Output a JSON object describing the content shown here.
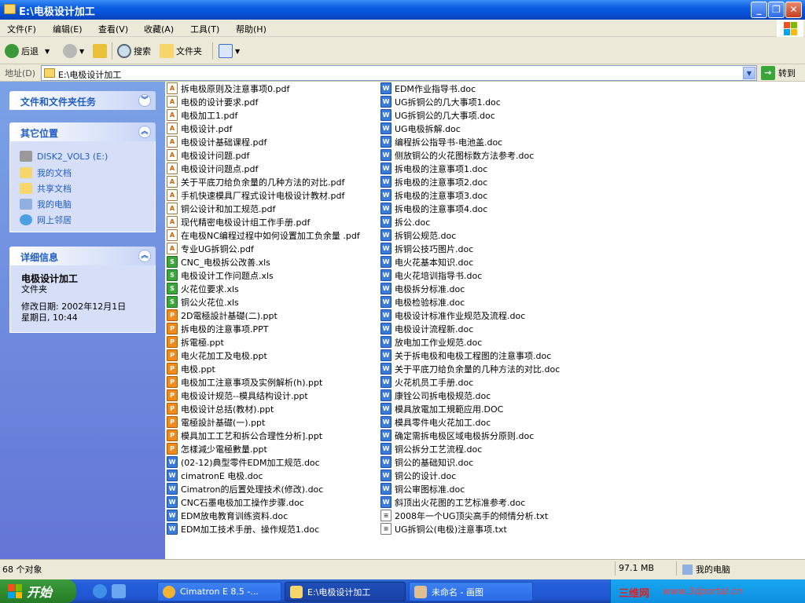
{
  "window": {
    "title": "E:\\电极设计加工"
  },
  "menu": [
    "文件(F)",
    "编辑(E)",
    "查看(V)",
    "收藏(A)",
    "工具(T)",
    "帮助(H)"
  ],
  "toolbar": {
    "back": "后退",
    "search": "搜索",
    "folders": "文件夹"
  },
  "address": {
    "label": "地址(D)",
    "path": "E:\\电极设计加工",
    "go": "转到"
  },
  "tasks_panel": {
    "title": "文件和文件夹任务"
  },
  "other_places": {
    "title": "其它位置",
    "items": [
      "DISK2_VOL3 (E:)",
      "我的文档",
      "共享文档",
      "我的电脑",
      "网上邻居"
    ]
  },
  "details": {
    "title": "详细信息",
    "name": "电极设计加工",
    "type": "文件夹",
    "modified_line1": "修改日期: 2002年12月1日",
    "modified_line2": "星期日, 10:44"
  },
  "files_col1": [
    {
      "name": "拆电极原则及注意事项0.pdf",
      "type": "pdf"
    },
    {
      "name": "电极的设计要求.pdf",
      "type": "pdf"
    },
    {
      "name": "电极加工1.pdf",
      "type": "pdf"
    },
    {
      "name": "电极设计.pdf",
      "type": "pdf"
    },
    {
      "name": "电极设计基础课程.pdf",
      "type": "pdf"
    },
    {
      "name": "电极设计问题.pdf",
      "type": "pdf"
    },
    {
      "name": "电极设计问题点.pdf",
      "type": "pdf"
    },
    {
      "name": "关于平底刀给负余量的几种方法的对比.pdf",
      "type": "pdf"
    },
    {
      "name": "手机快速模具厂程式设计电极设计教材.pdf",
      "type": "pdf"
    },
    {
      "name": "铜公设计和加工规范.pdf",
      "type": "pdf"
    },
    {
      "name": "现代精密电极设计组工作手册.pdf",
      "type": "pdf"
    },
    {
      "name": "在电极NC编程过程中如何设置加工负余量 .pdf",
      "type": "pdf"
    },
    {
      "name": "专业UG拆铜公.pdf",
      "type": "pdf"
    },
    {
      "name": "CNC_电极拆公改善.xls",
      "type": "xls"
    },
    {
      "name": "电极设计工作问题点.xls",
      "type": "xls"
    },
    {
      "name": "火花位要求.xls",
      "type": "xls"
    },
    {
      "name": "铜公火花位.xls",
      "type": "xls"
    },
    {
      "name": "2D電極設計基礎(二).ppt",
      "type": "ppt"
    },
    {
      "name": "拆电极的注意事项.PPT",
      "type": "ppt"
    },
    {
      "name": "拆電極.ppt",
      "type": "ppt"
    },
    {
      "name": "电火花加工及电极.ppt",
      "type": "ppt"
    },
    {
      "name": "电极.ppt",
      "type": "ppt"
    },
    {
      "name": "电极加工注意事项及实例解析(h).ppt",
      "type": "ppt"
    },
    {
      "name": "电极设计规范--模具结构设计.ppt",
      "type": "ppt"
    },
    {
      "name": "电极设计总括(教材).ppt",
      "type": "ppt"
    },
    {
      "name": "電極設計基礎(一).ppt",
      "type": "ppt"
    },
    {
      "name": "模具加工工艺和拆公合理性分析].ppt",
      "type": "ppt"
    },
    {
      "name": "怎樣減少電極數量.ppt",
      "type": "ppt"
    },
    {
      "name": "(02-12)典型零件EDM加工规范.doc",
      "type": "doc"
    },
    {
      "name": "cimatronE 电极.doc",
      "type": "doc"
    },
    {
      "name": "Cimatron的后置处理技术(修改).doc",
      "type": "doc"
    },
    {
      "name": "CNC石墨电极加工操作步骤.doc",
      "type": "doc"
    },
    {
      "name": "EDM放电教育训练资料.doc",
      "type": "doc"
    },
    {
      "name": "EDM加工技术手册、操作规范1.doc",
      "type": "doc"
    }
  ],
  "files_col2": [
    {
      "name": "EDM作业指导书.doc",
      "type": "doc"
    },
    {
      "name": "UG拆铜公的几大事项1.doc",
      "type": "doc"
    },
    {
      "name": "UG拆铜公的几大事项.doc",
      "type": "doc"
    },
    {
      "name": "UG电极拆解.doc",
      "type": "doc"
    },
    {
      "name": "编程拆公指导书-电池盖.doc",
      "type": "doc"
    },
    {
      "name": "侧放铜公的火花图标数方法参考.doc",
      "type": "doc"
    },
    {
      "name": "拆电极的注意事项1.doc",
      "type": "doc"
    },
    {
      "name": "拆电极的注意事项2.doc",
      "type": "doc"
    },
    {
      "name": "拆电极的注意事项3.doc",
      "type": "doc"
    },
    {
      "name": "拆电极的注意事项4.doc",
      "type": "doc"
    },
    {
      "name": "拆公.doc",
      "type": "doc"
    },
    {
      "name": "拆铜公规范.doc",
      "type": "doc"
    },
    {
      "name": "拆铜公技巧图片.doc",
      "type": "doc"
    },
    {
      "name": "电火花基本知识.doc",
      "type": "doc"
    },
    {
      "name": "电火花培训指导书.doc",
      "type": "doc"
    },
    {
      "name": "电极拆分标准.doc",
      "type": "doc"
    },
    {
      "name": "电极检验标准.doc",
      "type": "doc"
    },
    {
      "name": "电极设计标准作业规范及流程.doc",
      "type": "doc"
    },
    {
      "name": "电极设计流程新.doc",
      "type": "doc"
    },
    {
      "name": "放电加工作业规范.doc",
      "type": "doc"
    },
    {
      "name": "关于拆电极和电极工程图的注意事项.doc",
      "type": "doc"
    },
    {
      "name": "关于平底刀给负余量的几种方法的对比.doc",
      "type": "doc"
    },
    {
      "name": "火花机员工手册.doc",
      "type": "doc"
    },
    {
      "name": "康铨公司拆电极规范.doc",
      "type": "doc"
    },
    {
      "name": "模具放電加工規範应用.DOC",
      "type": "doc"
    },
    {
      "name": "模具零件电火花加工.doc",
      "type": "doc"
    },
    {
      "name": "确定需拆电极区域电极拆分原则.doc",
      "type": "doc"
    },
    {
      "name": "铜公拆分工艺流程.doc",
      "type": "doc"
    },
    {
      "name": "铜公的基础知识.doc",
      "type": "doc"
    },
    {
      "name": "铜公的设计.doc",
      "type": "doc"
    },
    {
      "name": "铜公审图标准.doc",
      "type": "doc"
    },
    {
      "name": "斜顶出火花图的工艺标准参考.doc",
      "type": "doc"
    },
    {
      "name": "2008年一个UG顶尖高手的倾情分析.txt",
      "type": "txt"
    },
    {
      "name": "UG拆铜公(电极)注意事项.txt",
      "type": "txt"
    }
  ],
  "status": {
    "count": "68 个对象",
    "size": "97.1 MB",
    "location": "我的电脑"
  },
  "taskbar": {
    "start": "开始",
    "tasks": [
      "Cimatron E 8.5 -...",
      "E:\\电极设计加工",
      "未命名 - 画图"
    ],
    "watermark": "三维网",
    "watermark_url": "www.3dportal.cn"
  },
  "colors": {
    "title_blue": "#0a5ce0",
    "pane_blue": "#7ba2e7",
    "link_blue": "#215dc6"
  }
}
